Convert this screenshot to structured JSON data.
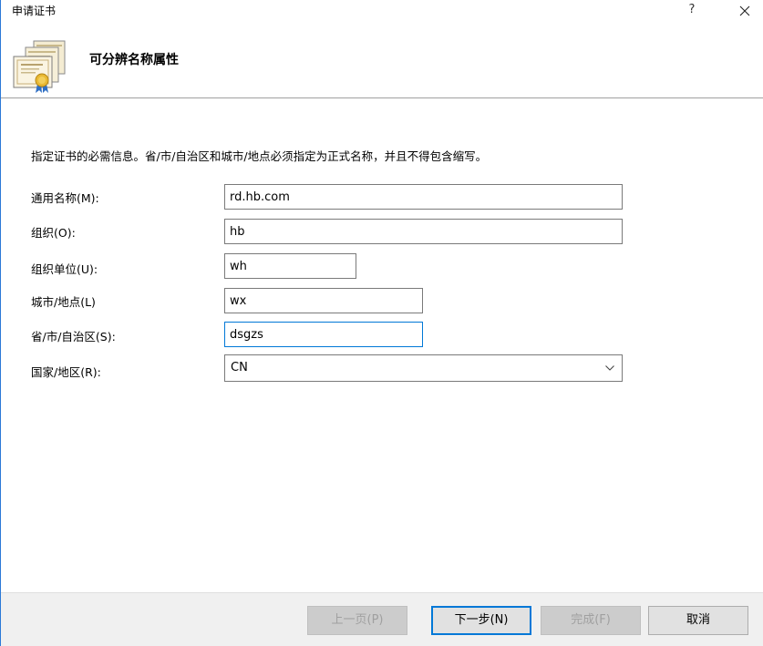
{
  "window": {
    "title": "申请证书",
    "help_glyph": "?"
  },
  "header": {
    "title": "可分辨名称属性",
    "icon": "certificate-stack-icon"
  },
  "instruction": "指定证书的必需信息。省/市/自治区和城市/地点必须指定为正式名称，并且不得包含缩写。",
  "fields": {
    "common_name": {
      "label": "通用名称(M):",
      "value": "rd.hb.com"
    },
    "organization": {
      "label": "组织(O):",
      "value": "hb"
    },
    "org_unit": {
      "label": "组织单位(U):",
      "value": "wh"
    },
    "city": {
      "label": "城市/地点(L)",
      "value": "wx"
    },
    "state": {
      "label": "省/市/自治区(S):",
      "value": "dsgzs"
    },
    "country": {
      "label": "国家/地区(R):",
      "value": "CN"
    }
  },
  "buttons": {
    "previous": "上一页(P)",
    "next": "下一步(N)",
    "finish": "完成(F)",
    "cancel": "取消"
  },
  "colors": {
    "accent": "#0078d7",
    "footer_bg": "#f0f0f0"
  }
}
